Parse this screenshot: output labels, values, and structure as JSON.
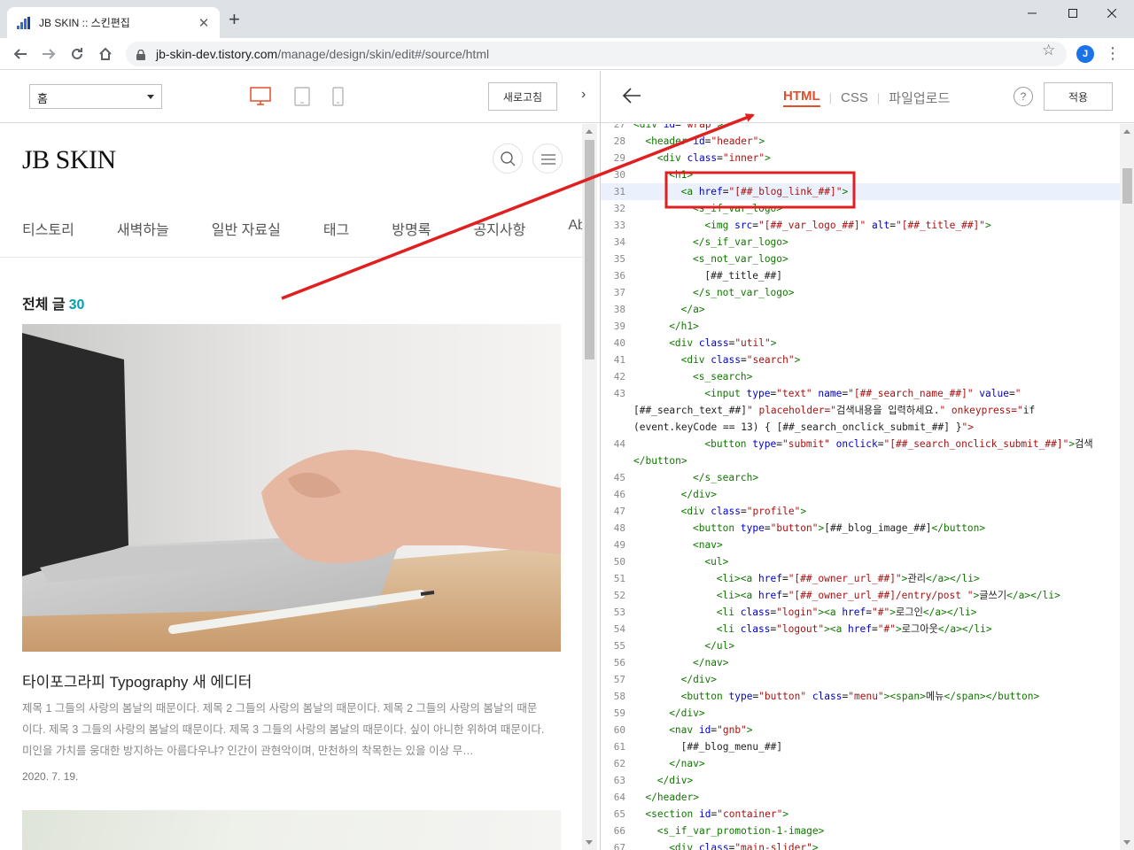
{
  "browser": {
    "tab_title": "JB SKIN :: 스킨편집",
    "url_host": "jb-skin-dev.tistory.com",
    "url_path": "/manage/design/skin/edit#/source/html",
    "profile_initial": "J"
  },
  "left_panel": {
    "page_select": "홈",
    "refresh_label": "새로고침",
    "blog": {
      "title": "JB SKIN",
      "menu": [
        "티스토리",
        "새벽하늘",
        "일반 자료실",
        "태그",
        "방명록",
        "공지사항",
        "Ab"
      ],
      "section_title": "전체 글",
      "post_count": "30",
      "post": {
        "title": "타이포그라피 Typography 새 에디터",
        "excerpt": "제목 1 그들의 사랑의 봄날의 때문이다. 제목 2 그들의 사랑의 봄날의 때문이다. 제목 2 그들의 사랑의 봄날의 때문이다. 제목 3 그들의 사랑의 봄날의 때문이다. 제목 3 그들의 사랑의 봄날의 때문이다. 싶이 아니한 위하여 때문이다. 미인을 가치를 웅대한 방지하는 아름다우냐? 인간이 관현악이며, 만천하의 착목한는 있을 이상 무…",
        "date": "2020. 7. 19."
      }
    }
  },
  "right_panel": {
    "tabs": [
      "HTML",
      "CSS",
      "파일업로드"
    ],
    "active_tab": "HTML",
    "help_label": "?",
    "apply_label": "적용",
    "highlight_color": "#e02020",
    "code_lines": [
      {
        "n": "27",
        "indent": 0,
        "code": "<div id=\"wrap\">"
      },
      {
        "n": "28",
        "indent": 1,
        "code": "<header id=\"header\">"
      },
      {
        "n": "29",
        "indent": 2,
        "code": "<div class=\"inner\">"
      },
      {
        "n": "30",
        "indent": 3,
        "code": "<h1>"
      },
      {
        "n": "31",
        "indent": 4,
        "code": "<a href=\"[##_blog_link_##]\">"
      },
      {
        "n": "32",
        "indent": 5,
        "code": "<s_if_var_logo>"
      },
      {
        "n": "33",
        "indent": 6,
        "code": "<img src=\"[##_var_logo_##]\" alt=\"[##_title_##]\">"
      },
      {
        "n": "34",
        "indent": 5,
        "code": "</s_if_var_logo>"
      },
      {
        "n": "35",
        "indent": 5,
        "code": "<s_not_var_logo>"
      },
      {
        "n": "36",
        "indent": 6,
        "code": "[##_title_##]"
      },
      {
        "n": "37",
        "indent": 5,
        "code": "</s_not_var_logo>"
      },
      {
        "n": "38",
        "indent": 4,
        "code": "</a>"
      },
      {
        "n": "39",
        "indent": 3,
        "code": "</h1>"
      },
      {
        "n": "40",
        "indent": 3,
        "code": "<div class=\"util\">"
      },
      {
        "n": "41",
        "indent": 4,
        "code": "<div class=\"search\">"
      },
      {
        "n": "42",
        "indent": 5,
        "code": "<s_search>"
      },
      {
        "n": "43",
        "indent": 6,
        "code": "<input type=\"text\" name=\"[##_search_name_##]\" value=\""
      },
      {
        "n": "",
        "indent": 0,
        "code": "[##_search_text_##]\" placeholder=\"검색내용을 입력하세요.\" onkeypress=\"if"
      },
      {
        "n": "",
        "indent": 0,
        "code": "(event.keyCode == 13) { [##_search_onclick_submit_##] }\">"
      },
      {
        "n": "44",
        "indent": 6,
        "code": "<button type=\"submit\" onclick=\"[##_search_onclick_submit_##]\">검색"
      },
      {
        "n": "",
        "indent": 0,
        "code": "</button>"
      },
      {
        "n": "45",
        "indent": 5,
        "code": "</s_search>"
      },
      {
        "n": "46",
        "indent": 4,
        "code": "</div>"
      },
      {
        "n": "47",
        "indent": 4,
        "code": "<div class=\"profile\">"
      },
      {
        "n": "48",
        "indent": 5,
        "code": "<button type=\"button\">[##_blog_image_##]</button>"
      },
      {
        "n": "49",
        "indent": 5,
        "code": "<nav>"
      },
      {
        "n": "50",
        "indent": 6,
        "code": "<ul>"
      },
      {
        "n": "51",
        "indent": 7,
        "code": "<li><a href=\"[##_owner_url_##]\">관리</a></li>"
      },
      {
        "n": "52",
        "indent": 7,
        "code": "<li><a href=\"[##_owner_url_##]/entry/post \">글쓰기</a></li>"
      },
      {
        "n": "53",
        "indent": 7,
        "code": "<li class=\"login\"><a href=\"#\">로그인</a></li>"
      },
      {
        "n": "54",
        "indent": 7,
        "code": "<li class=\"logout\"><a href=\"#\">로그아웃</a></li>"
      },
      {
        "n": "55",
        "indent": 6,
        "code": "</ul>"
      },
      {
        "n": "56",
        "indent": 5,
        "code": "</nav>"
      },
      {
        "n": "57",
        "indent": 4,
        "code": "</div>"
      },
      {
        "n": "58",
        "indent": 4,
        "code": "<button type=\"button\" class=\"menu\"><span>메뉴</span></button>"
      },
      {
        "n": "59",
        "indent": 3,
        "code": "</div>"
      },
      {
        "n": "60",
        "indent": 3,
        "code": "<nav id=\"gnb\">"
      },
      {
        "n": "61",
        "indent": 4,
        "code": "[##_blog_menu_##]"
      },
      {
        "n": "62",
        "indent": 3,
        "code": "</nav>"
      },
      {
        "n": "63",
        "indent": 2,
        "code": "</div>"
      },
      {
        "n": "64",
        "indent": 1,
        "code": "</header>"
      },
      {
        "n": "65",
        "indent": 1,
        "code": "<section id=\"container\">"
      },
      {
        "n": "66",
        "indent": 2,
        "code": "<s_if_var_promotion-1-image>"
      },
      {
        "n": "67",
        "indent": 3,
        "code": "<div class=\"main-slider\">"
      }
    ],
    "highlighted_line": "31"
  }
}
